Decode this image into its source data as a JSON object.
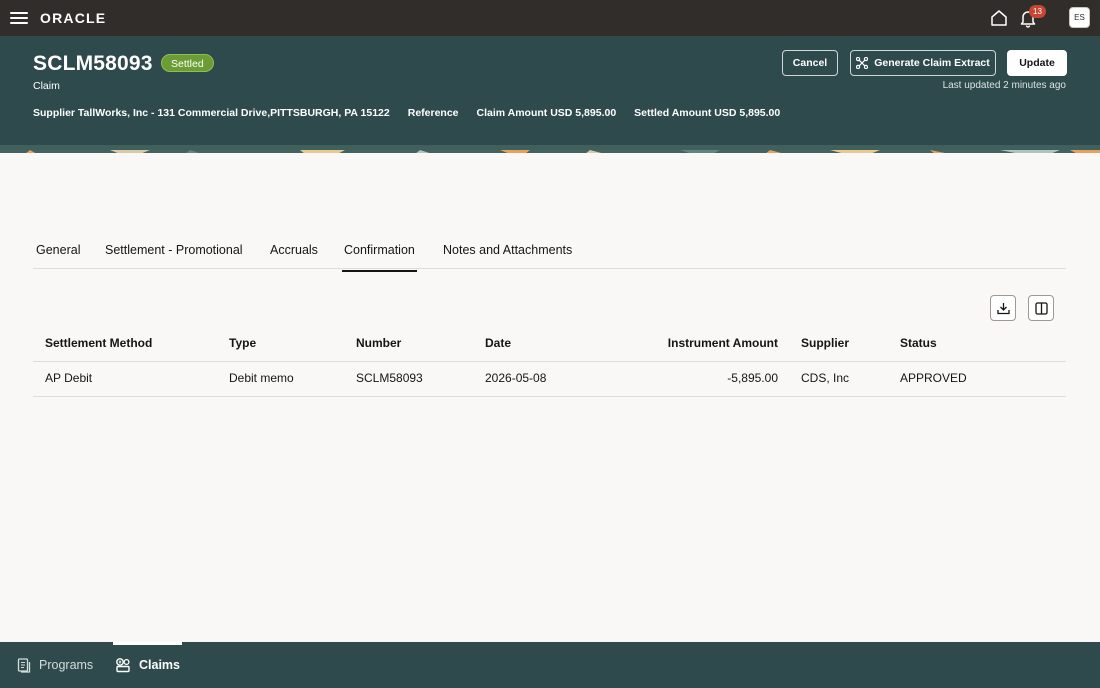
{
  "topbar": {
    "brand": "ORACLE",
    "notification_count": "13",
    "user_initials": "ES"
  },
  "header": {
    "claim_id": "SCLM58093",
    "status_badge": "Settled",
    "subtitle": "Claim",
    "last_updated": "Last updated 2 minutes ago",
    "buttons": {
      "cancel": "Cancel",
      "extract": "Generate Claim Extract",
      "update": "Update"
    },
    "meta": {
      "supplier": "Supplier TallWorks, Inc - 131 Commercial Drive,PITTSBURGH, PA 15122",
      "reference": "Reference",
      "claim_amount": "Claim Amount USD 5,895.00",
      "settled_amount": "Settled Amount USD 5,895.00"
    }
  },
  "tabs": [
    {
      "label": "General"
    },
    {
      "label": "Settlement - Promotional"
    },
    {
      "label": "Accruals"
    },
    {
      "label": "Confirmation"
    },
    {
      "label": "Notes and Attachments"
    }
  ],
  "active_tab": "Confirmation",
  "table": {
    "columns": [
      "Settlement Method",
      "Type",
      "Number",
      "Date",
      "Instrument Amount",
      "Supplier",
      "Status"
    ],
    "rows": [
      [
        "AP Debit",
        "Debit memo",
        "SCLM58093",
        "2026-05-08",
        "-5,895.00",
        "CDS, Inc",
        "APPROVED"
      ]
    ]
  },
  "bottom_nav": {
    "programs": "Programs",
    "claims": "Claims"
  },
  "colors": {
    "topbar": "#312d2a",
    "header": "#2e4a4c",
    "badge": "#6c9c35",
    "notification": "#c74634"
  }
}
